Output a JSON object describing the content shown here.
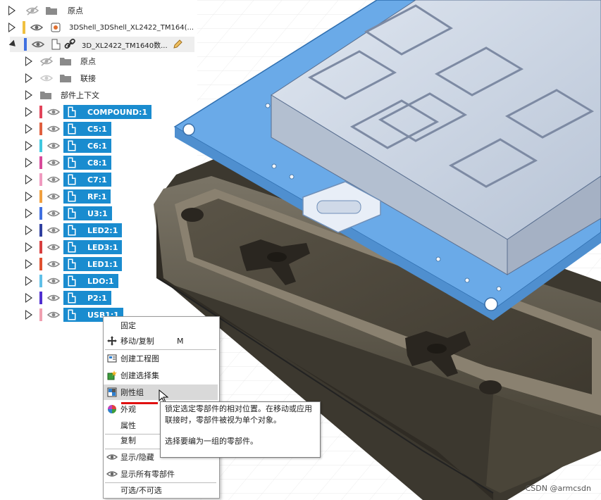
{
  "browser": {
    "items": [
      {
        "label": "原点"
      },
      {
        "label": "3DShell_3DShell_XL2422_TM164(..."
      },
      {
        "label": "3D_XL2422_TM1640数..."
      },
      {
        "label": "原点"
      },
      {
        "label": "联接"
      },
      {
        "label": "部件上下文"
      }
    ],
    "components": [
      {
        "label": "COMPOUND:1",
        "color": "#e2445a"
      },
      {
        "label": "C5:1",
        "color": "#e06040"
      },
      {
        "label": "C6:1",
        "color": "#40c8e0"
      },
      {
        "label": "C8:1",
        "color": "#d84a9a"
      },
      {
        "label": "C7:1",
        "color": "#f09ac0"
      },
      {
        "label": "RF:1",
        "color": "#f0a040"
      },
      {
        "label": "U3:1",
        "color": "#4070e0"
      },
      {
        "label": "LED2:1",
        "color": "#3040a0"
      },
      {
        "label": "LED3:1",
        "color": "#d84040"
      },
      {
        "label": "LED1:1",
        "color": "#e05030"
      },
      {
        "label": "LDO:1",
        "color": "#60c0e8"
      },
      {
        "label": "P2:1",
        "color": "#5030d0"
      },
      {
        "label": "USB1:1",
        "color": "#f0a0b0"
      }
    ]
  },
  "menu": {
    "items": [
      {
        "label": "固定",
        "icon": "none"
      },
      {
        "label": "移动/复制",
        "shortcut": "M",
        "icon": "move-icon"
      },
      {
        "label": "创建工程图",
        "icon": "drawing-icon"
      },
      {
        "label": "创建选择集",
        "icon": "selection-set-icon"
      },
      {
        "label": "刚性组",
        "icon": "rigid-group-icon"
      },
      {
        "label": "外观",
        "icon": "appearance-icon"
      },
      {
        "label": "属性",
        "icon": "none"
      },
      {
        "label": "复制",
        "icon": "none"
      },
      {
        "label": "显示/隐藏",
        "icon": "eye-icon"
      },
      {
        "label": "显示所有零部件",
        "icon": "eye-icon"
      },
      {
        "label": "可选/不可选",
        "icon": "none"
      }
    ]
  },
  "tooltip": {
    "line1": "锁定选定零部件的相对位置。在移动或应用联接时，零部件被视为单个对象。",
    "line2": "选择要编为一组的零部件。"
  },
  "watermark": "CSDN @armcsdn",
  "colors": {
    "selection": "#1a8ccf",
    "board": "#6aaae8",
    "case": "#6b6455"
  }
}
